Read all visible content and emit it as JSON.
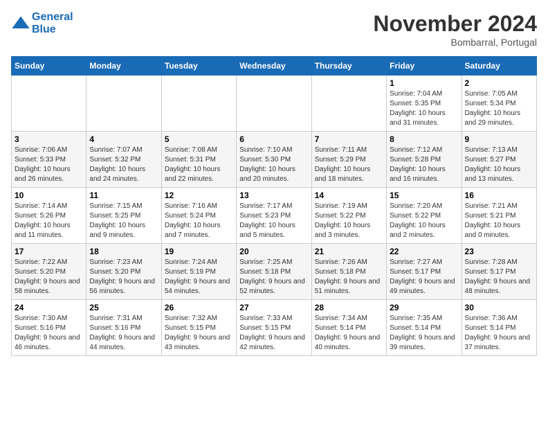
{
  "header": {
    "logo_line1": "General",
    "logo_line2": "Blue",
    "month_title": "November 2024",
    "location": "Bombarral, Portugal"
  },
  "weekdays": [
    "Sunday",
    "Monday",
    "Tuesday",
    "Wednesday",
    "Thursday",
    "Friday",
    "Saturday"
  ],
  "weeks": [
    [
      {
        "day": "",
        "info": ""
      },
      {
        "day": "",
        "info": ""
      },
      {
        "day": "",
        "info": ""
      },
      {
        "day": "",
        "info": ""
      },
      {
        "day": "",
        "info": ""
      },
      {
        "day": "1",
        "info": "Sunrise: 7:04 AM\nSunset: 5:35 PM\nDaylight: 10 hours and 31 minutes."
      },
      {
        "day": "2",
        "info": "Sunrise: 7:05 AM\nSunset: 5:34 PM\nDaylight: 10 hours and 29 minutes."
      }
    ],
    [
      {
        "day": "3",
        "info": "Sunrise: 7:06 AM\nSunset: 5:33 PM\nDaylight: 10 hours and 26 minutes."
      },
      {
        "day": "4",
        "info": "Sunrise: 7:07 AM\nSunset: 5:32 PM\nDaylight: 10 hours and 24 minutes."
      },
      {
        "day": "5",
        "info": "Sunrise: 7:08 AM\nSunset: 5:31 PM\nDaylight: 10 hours and 22 minutes."
      },
      {
        "day": "6",
        "info": "Sunrise: 7:10 AM\nSunset: 5:30 PM\nDaylight: 10 hours and 20 minutes."
      },
      {
        "day": "7",
        "info": "Sunrise: 7:11 AM\nSunset: 5:29 PM\nDaylight: 10 hours and 18 minutes."
      },
      {
        "day": "8",
        "info": "Sunrise: 7:12 AM\nSunset: 5:28 PM\nDaylight: 10 hours and 16 minutes."
      },
      {
        "day": "9",
        "info": "Sunrise: 7:13 AM\nSunset: 5:27 PM\nDaylight: 10 hours and 13 minutes."
      }
    ],
    [
      {
        "day": "10",
        "info": "Sunrise: 7:14 AM\nSunset: 5:26 PM\nDaylight: 10 hours and 11 minutes."
      },
      {
        "day": "11",
        "info": "Sunrise: 7:15 AM\nSunset: 5:25 PM\nDaylight: 10 hours and 9 minutes."
      },
      {
        "day": "12",
        "info": "Sunrise: 7:16 AM\nSunset: 5:24 PM\nDaylight: 10 hours and 7 minutes."
      },
      {
        "day": "13",
        "info": "Sunrise: 7:17 AM\nSunset: 5:23 PM\nDaylight: 10 hours and 5 minutes."
      },
      {
        "day": "14",
        "info": "Sunrise: 7:19 AM\nSunset: 5:22 PM\nDaylight: 10 hours and 3 minutes."
      },
      {
        "day": "15",
        "info": "Sunrise: 7:20 AM\nSunset: 5:22 PM\nDaylight: 10 hours and 2 minutes."
      },
      {
        "day": "16",
        "info": "Sunrise: 7:21 AM\nSunset: 5:21 PM\nDaylight: 10 hours and 0 minutes."
      }
    ],
    [
      {
        "day": "17",
        "info": "Sunrise: 7:22 AM\nSunset: 5:20 PM\nDaylight: 9 hours and 58 minutes."
      },
      {
        "day": "18",
        "info": "Sunrise: 7:23 AM\nSunset: 5:20 PM\nDaylight: 9 hours and 56 minutes."
      },
      {
        "day": "19",
        "info": "Sunrise: 7:24 AM\nSunset: 5:19 PM\nDaylight: 9 hours and 54 minutes."
      },
      {
        "day": "20",
        "info": "Sunrise: 7:25 AM\nSunset: 5:18 PM\nDaylight: 9 hours and 52 minutes."
      },
      {
        "day": "21",
        "info": "Sunrise: 7:26 AM\nSunset: 5:18 PM\nDaylight: 9 hours and 51 minutes."
      },
      {
        "day": "22",
        "info": "Sunrise: 7:27 AM\nSunset: 5:17 PM\nDaylight: 9 hours and 49 minutes."
      },
      {
        "day": "23",
        "info": "Sunrise: 7:28 AM\nSunset: 5:17 PM\nDaylight: 9 hours and 48 minutes."
      }
    ],
    [
      {
        "day": "24",
        "info": "Sunrise: 7:30 AM\nSunset: 5:16 PM\nDaylight: 9 hours and 46 minutes."
      },
      {
        "day": "25",
        "info": "Sunrise: 7:31 AM\nSunset: 5:16 PM\nDaylight: 9 hours and 44 minutes."
      },
      {
        "day": "26",
        "info": "Sunrise: 7:32 AM\nSunset: 5:15 PM\nDaylight: 9 hours and 43 minutes."
      },
      {
        "day": "27",
        "info": "Sunrise: 7:33 AM\nSunset: 5:15 PM\nDaylight: 9 hours and 42 minutes."
      },
      {
        "day": "28",
        "info": "Sunrise: 7:34 AM\nSunset: 5:14 PM\nDaylight: 9 hours and 40 minutes."
      },
      {
        "day": "29",
        "info": "Sunrise: 7:35 AM\nSunset: 5:14 PM\nDaylight: 9 hours and 39 minutes."
      },
      {
        "day": "30",
        "info": "Sunrise: 7:36 AM\nSunset: 5:14 PM\nDaylight: 9 hours and 37 minutes."
      }
    ]
  ]
}
